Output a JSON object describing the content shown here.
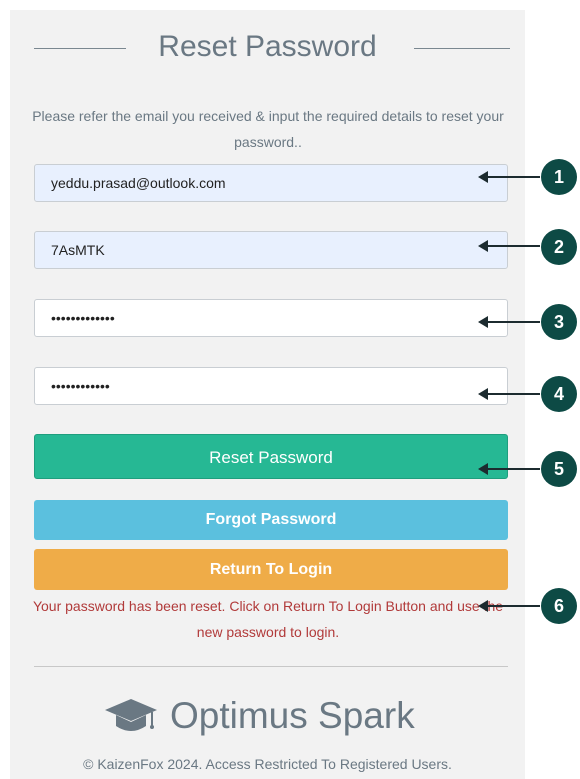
{
  "form": {
    "title": "Reset Password",
    "instructions": "Please refer the email you received & input the required details to reset your password..",
    "email_value": "yeddu.prasad@outlook.com",
    "code_value": "7AsMTK",
    "new_password_value": "•••••••••••••",
    "confirm_password_value": "••••••••••••",
    "reset_button": "Reset Password",
    "forgot_button": "Forgot Password",
    "return_button": "Return To Login",
    "success_message": "Your password has been reset. Click on Return To Login Button and use the new password to login."
  },
  "brand": {
    "name": "Optimus Spark",
    "icon": "graduation-cap-icon"
  },
  "footer": {
    "text": "© KaizenFox 2024. Access Restricted To Registered Users."
  },
  "callouts": [
    "1",
    "2",
    "3",
    "4",
    "5",
    "6"
  ],
  "colors": {
    "reset_button": "#26b894",
    "forgot_button": "#5bc0de",
    "return_button": "#efac48",
    "message": "#b13a3a",
    "callout": "#0d4a45"
  }
}
